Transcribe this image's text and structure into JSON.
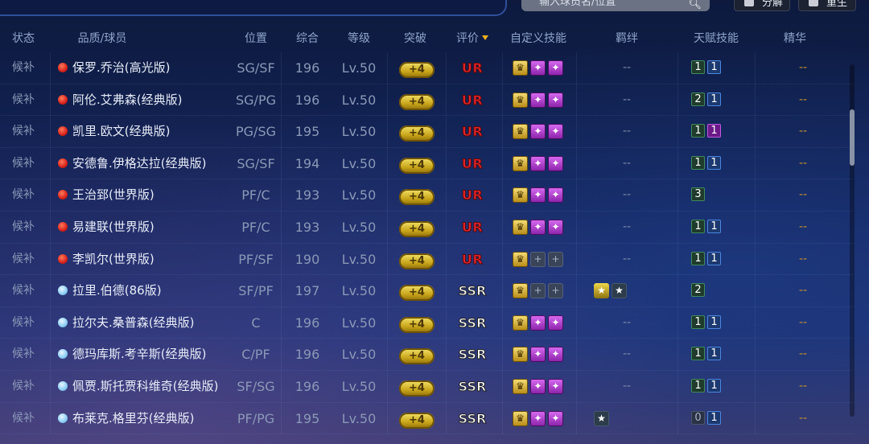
{
  "toolbar": {
    "search_placeholder": "输入球员名/位置",
    "decompose_label": "分解",
    "rebirth_label": "重生"
  },
  "header": {
    "status": "状态",
    "player": "品质/球员",
    "position": "位置",
    "overall": "综合",
    "level": "等级",
    "breakthrough": "突破",
    "rating": "评价",
    "custom_skills": "自定义技能",
    "fetters": "羁绊",
    "talent_skills": "天赋技能",
    "essence": "精华"
  },
  "rows": [
    {
      "status": "候补",
      "quality": "red",
      "name": "保罗.乔治(高光版)",
      "position": "SG/SF",
      "overall": "196",
      "level": "Lv.50",
      "breakthrough": "+4",
      "rating": "UR",
      "skills": [
        "gold",
        "purple",
        "purple"
      ],
      "fetter": "--",
      "talents": [
        {
          "v": "1",
          "c": "green"
        },
        {
          "v": "1",
          "c": "blue"
        }
      ],
      "essence": "--"
    },
    {
      "status": "候补",
      "quality": "red",
      "name": "阿伦.艾弗森(经典版)",
      "position": "SG/PG",
      "overall": "196",
      "level": "Lv.50",
      "breakthrough": "+4",
      "rating": "UR",
      "skills": [
        "gold",
        "purple",
        "purple"
      ],
      "fetter": "--",
      "talents": [
        {
          "v": "2",
          "c": "green"
        },
        {
          "v": "1",
          "c": "blue"
        }
      ],
      "essence": "--"
    },
    {
      "status": "候补",
      "quality": "red",
      "name": "凯里.欧文(经典版)",
      "position": "PG/SG",
      "overall": "195",
      "level": "Lv.50",
      "breakthrough": "+4",
      "rating": "UR",
      "skills": [
        "gold",
        "purple",
        "purple"
      ],
      "fetter": "--",
      "talents": [
        {
          "v": "1",
          "c": "green"
        },
        {
          "v": "1",
          "c": "purple"
        }
      ],
      "essence": "--"
    },
    {
      "status": "候补",
      "quality": "red",
      "name": "安德鲁.伊格达拉(经典版)",
      "position": "SG/SF",
      "overall": "194",
      "level": "Lv.50",
      "breakthrough": "+4",
      "rating": "UR",
      "skills": [
        "gold",
        "purple",
        "purple"
      ],
      "fetter": "--",
      "talents": [
        {
          "v": "1",
          "c": "green"
        },
        {
          "v": "1",
          "c": "blue"
        }
      ],
      "essence": "--"
    },
    {
      "status": "候补",
      "quality": "red",
      "name": "王治郅(世界版)",
      "position": "PF/C",
      "overall": "193",
      "level": "Lv.50",
      "breakthrough": "+4",
      "rating": "UR",
      "skills": [
        "gold",
        "purple",
        "purple"
      ],
      "fetter": "--",
      "talents": [
        {
          "v": "3",
          "c": "green"
        }
      ],
      "essence": "--"
    },
    {
      "status": "候补",
      "quality": "red",
      "name": "易建联(世界版)",
      "position": "PF/C",
      "overall": "193",
      "level": "Lv.50",
      "breakthrough": "+4",
      "rating": "UR",
      "skills": [
        "gold",
        "purple",
        "purple"
      ],
      "fetter": "--",
      "talents": [
        {
          "v": "1",
          "c": "green"
        },
        {
          "v": "1",
          "c": "blue"
        }
      ],
      "essence": "--"
    },
    {
      "status": "候补",
      "quality": "red",
      "name": "李凯尔(世界版)",
      "position": "PF/SF",
      "overall": "190",
      "level": "Lv.50",
      "breakthrough": "+4",
      "rating": "UR",
      "skills": [
        "gold",
        "empty",
        "empty"
      ],
      "fetter": "--",
      "talents": [
        {
          "v": "1",
          "c": "green"
        },
        {
          "v": "1",
          "c": "blue"
        }
      ],
      "essence": "--"
    },
    {
      "status": "候补",
      "quality": "blue",
      "name": "拉里.伯德(86版)",
      "position": "SF/PF",
      "overall": "197",
      "level": "Lv.50",
      "breakthrough": "+4",
      "rating": "SSR",
      "skills": [
        "gold",
        "empty",
        "empty"
      ],
      "fetter": "icons",
      "talents": [
        {
          "v": "2",
          "c": "green"
        }
      ],
      "essence": "--"
    },
    {
      "status": "候补",
      "quality": "blue",
      "name": "拉尔夫.桑普森(经典版)",
      "position": "C",
      "overall": "196",
      "level": "Lv.50",
      "breakthrough": "+4",
      "rating": "SSR",
      "skills": [
        "gold",
        "purple",
        "purple"
      ],
      "fetter": "--",
      "talents": [
        {
          "v": "1",
          "c": "green"
        },
        {
          "v": "1",
          "c": "blue"
        }
      ],
      "essence": "--"
    },
    {
      "status": "候补",
      "quality": "blue",
      "name": "德玛库斯.考辛斯(经典版)",
      "position": "C/PF",
      "overall": "196",
      "level": "Lv.50",
      "breakthrough": "+4",
      "rating": "SSR",
      "skills": [
        "gold",
        "purple",
        "purple"
      ],
      "fetter": "--",
      "talents": [
        {
          "v": "1",
          "c": "green"
        },
        {
          "v": "1",
          "c": "blue"
        }
      ],
      "essence": "--"
    },
    {
      "status": "候补",
      "quality": "blue",
      "name": "佩贾.斯托贾科维奇(经典版)",
      "position": "SF/SG",
      "overall": "196",
      "level": "Lv.50",
      "breakthrough": "+4",
      "rating": "SSR",
      "skills": [
        "gold",
        "purple",
        "purple"
      ],
      "fetter": "--",
      "talents": [
        {
          "v": "1",
          "c": "green"
        },
        {
          "v": "1",
          "c": "blue"
        }
      ],
      "essence": "--"
    },
    {
      "status": "候补",
      "quality": "blue",
      "name": "布莱克.格里芬(经典版)",
      "position": "PF/PG",
      "overall": "195",
      "level": "Lv.50",
      "breakthrough": "+4",
      "rating": "SSR",
      "skills": [
        "gold",
        "purple",
        "purple"
      ],
      "fetter": "icon1",
      "talents": [
        {
          "v": "0",
          "c": "grey"
        },
        {
          "v": "1",
          "c": "blue"
        }
      ],
      "essence": "--"
    }
  ]
}
